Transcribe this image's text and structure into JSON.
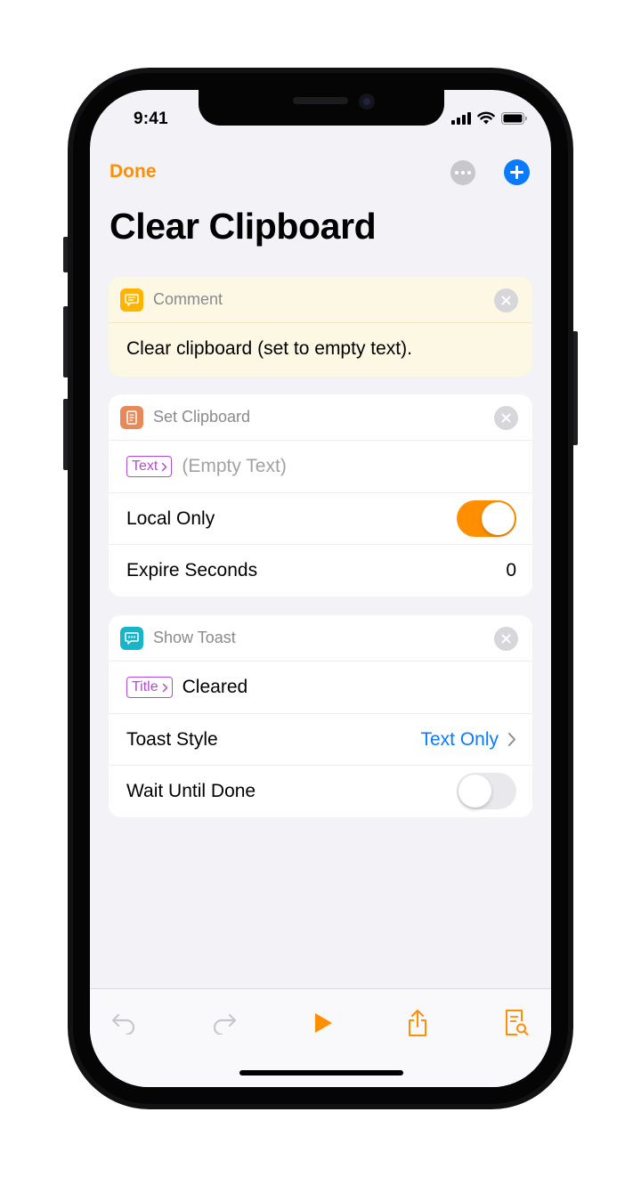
{
  "status_bar": {
    "time": "9:41"
  },
  "nav": {
    "done_label": "Done"
  },
  "page": {
    "title": "Clear Clipboard"
  },
  "actions": {
    "comment": {
      "title": "Comment",
      "text": "Clear clipboard (set to empty text).",
      "icon_color": "#ffb400"
    },
    "set_clipboard": {
      "title": "Set Clipboard",
      "icon_color": "#e58a58",
      "text_param": {
        "token": "Text",
        "value": "(Empty Text)"
      },
      "local_only": {
        "label": "Local Only",
        "enabled": true
      },
      "expire_seconds": {
        "label": "Expire Seconds",
        "value": "0"
      }
    },
    "show_toast": {
      "title": "Show Toast",
      "icon_color": "#18b5c9",
      "title_param": {
        "token": "Title",
        "value": "Cleared"
      },
      "toast_style": {
        "label": "Toast Style",
        "value": "Text Only"
      },
      "wait_until_done": {
        "label": "Wait Until Done",
        "enabled": false
      }
    }
  },
  "toolbar": {
    "buttons": [
      "undo-icon",
      "redo-icon",
      "play-icon",
      "share-icon",
      "document-search-icon"
    ]
  },
  "colors": {
    "accent": "#ff8f00",
    "link": "#0a7aff",
    "token": "#b54ad6"
  }
}
